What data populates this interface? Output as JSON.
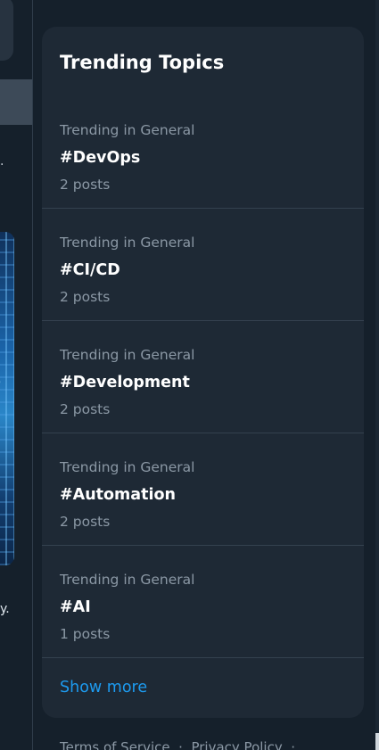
{
  "trending": {
    "title": "Trending Topics",
    "topics": [
      {
        "context": "Trending in General",
        "name": "#DevOps",
        "count": "2 posts"
      },
      {
        "context": "Trending in General",
        "name": "#CI/CD",
        "count": "2 posts"
      },
      {
        "context": "Trending in General",
        "name": "#Development",
        "count": "2 posts"
      },
      {
        "context": "Trending in General",
        "name": "#Automation",
        "count": "2 posts"
      },
      {
        "context": "Trending in General",
        "name": "#AI",
        "count": "1 posts"
      }
    ],
    "show_more": "Show more"
  },
  "footer": {
    "terms": "Terms of Service",
    "privacy": "Privacy Policy",
    "separator": "·"
  },
  "left_feed": {
    "dot": "·",
    "text_fragment": "y."
  },
  "colors": {
    "background": "#15202b",
    "card": "#1e2935",
    "accent": "#1d9bf0",
    "muted_text": "#8b98a5"
  }
}
